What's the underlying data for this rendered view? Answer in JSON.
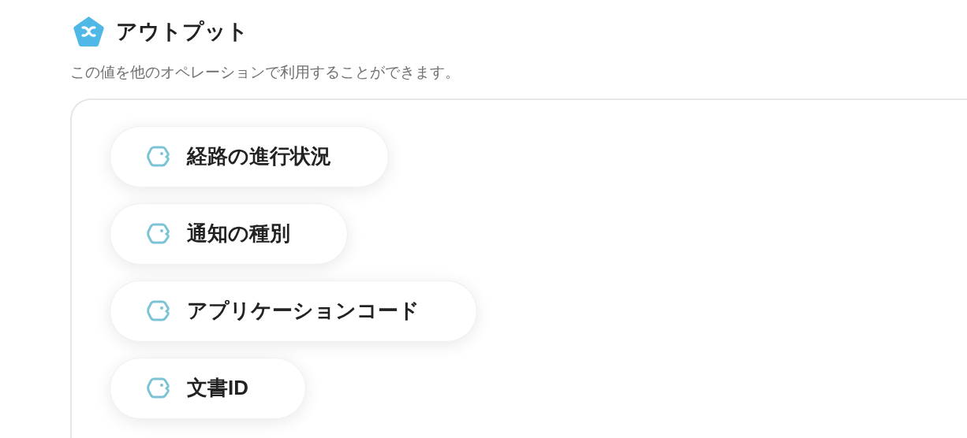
{
  "header": {
    "title": "アウトプット",
    "description": "この値を他のオペレーションで利用することができます。"
  },
  "outputs": [
    {
      "label": "経路の進行状況"
    },
    {
      "label": "通知の種別"
    },
    {
      "label": "アプリケーションコード"
    },
    {
      "label": "文書ID"
    }
  ]
}
